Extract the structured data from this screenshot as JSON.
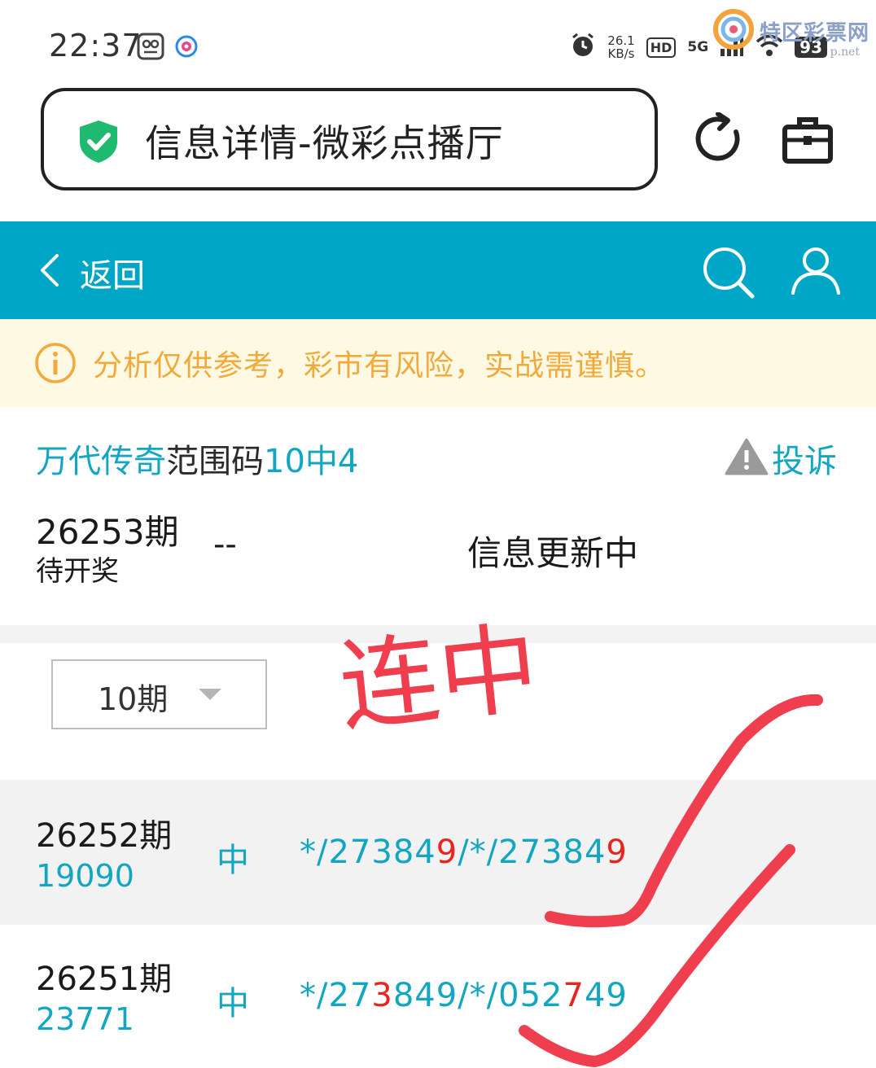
{
  "status_bar": {
    "time": "22:37",
    "speed_value": "26.1",
    "speed_unit": "KB/s",
    "hd": "HD",
    "net": "5G",
    "battery": "93"
  },
  "watermark": {
    "name": "特区彩票网",
    "url": "p.net"
  },
  "browser": {
    "title": "信息详情-微彩点播厅",
    "shield_color": "#1fba6f"
  },
  "header": {
    "back_label": "返回",
    "bg_color": "#00a6c5"
  },
  "notice": {
    "text": "分析仅供参考，彩市有风险，实战需谨慎。"
  },
  "post": {
    "title_part1": "万代传奇",
    "title_part2": "范围码",
    "title_part3": "10中4",
    "complain_label": "投诉",
    "current_period": "26253期",
    "current_status": "待开奖",
    "current_dashes": "--",
    "current_info": "信息更新中"
  },
  "filter": {
    "selected": "10期"
  },
  "annotation": {
    "text": "连中"
  },
  "history": [
    {
      "period": "26252期",
      "code": "19090",
      "mark": "中",
      "nums_a": "*/27384",
      "nums_b": "9",
      "nums_c": "/*/27384",
      "nums_d": "9"
    },
    {
      "period": "26251期",
      "code": "23771",
      "mark": "中",
      "nums_a": "*/27",
      "nums_b": "3",
      "nums_c": "849/*/052",
      "nums_d": "7",
      "nums_e": "49"
    }
  ]
}
